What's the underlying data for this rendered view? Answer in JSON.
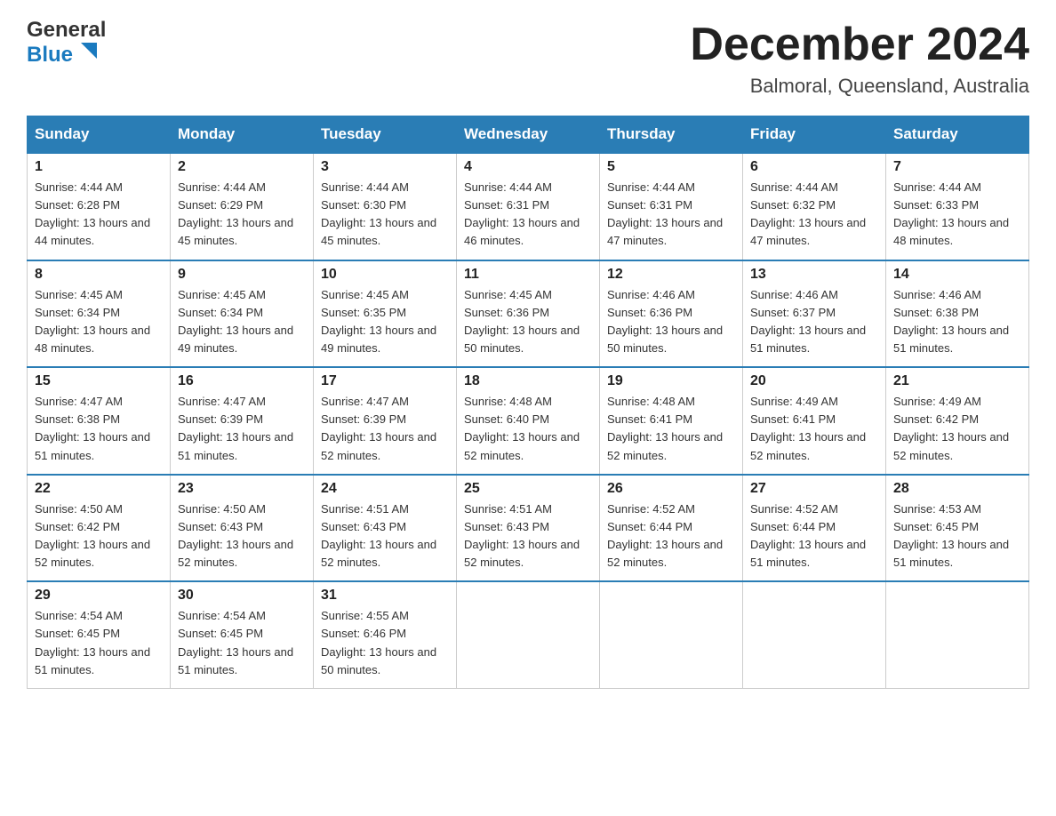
{
  "header": {
    "logo_line1": "General",
    "logo_line2": "Blue",
    "month_title": "December 2024",
    "location": "Balmoral, Queensland, Australia"
  },
  "days_of_week": [
    "Sunday",
    "Monday",
    "Tuesday",
    "Wednesday",
    "Thursday",
    "Friday",
    "Saturday"
  ],
  "weeks": [
    [
      {
        "day": "1",
        "sunrise": "4:44 AM",
        "sunset": "6:28 PM",
        "daylight": "13 hours and 44 minutes."
      },
      {
        "day": "2",
        "sunrise": "4:44 AM",
        "sunset": "6:29 PM",
        "daylight": "13 hours and 45 minutes."
      },
      {
        "day": "3",
        "sunrise": "4:44 AM",
        "sunset": "6:30 PM",
        "daylight": "13 hours and 45 minutes."
      },
      {
        "day": "4",
        "sunrise": "4:44 AM",
        "sunset": "6:31 PM",
        "daylight": "13 hours and 46 minutes."
      },
      {
        "day": "5",
        "sunrise": "4:44 AM",
        "sunset": "6:31 PM",
        "daylight": "13 hours and 47 minutes."
      },
      {
        "day": "6",
        "sunrise": "4:44 AM",
        "sunset": "6:32 PM",
        "daylight": "13 hours and 47 minutes."
      },
      {
        "day": "7",
        "sunrise": "4:44 AM",
        "sunset": "6:33 PM",
        "daylight": "13 hours and 48 minutes."
      }
    ],
    [
      {
        "day": "8",
        "sunrise": "4:45 AM",
        "sunset": "6:34 PM",
        "daylight": "13 hours and 48 minutes."
      },
      {
        "day": "9",
        "sunrise": "4:45 AM",
        "sunset": "6:34 PM",
        "daylight": "13 hours and 49 minutes."
      },
      {
        "day": "10",
        "sunrise": "4:45 AM",
        "sunset": "6:35 PM",
        "daylight": "13 hours and 49 minutes."
      },
      {
        "day": "11",
        "sunrise": "4:45 AM",
        "sunset": "6:36 PM",
        "daylight": "13 hours and 50 minutes."
      },
      {
        "day": "12",
        "sunrise": "4:46 AM",
        "sunset": "6:36 PM",
        "daylight": "13 hours and 50 minutes."
      },
      {
        "day": "13",
        "sunrise": "4:46 AM",
        "sunset": "6:37 PM",
        "daylight": "13 hours and 51 minutes."
      },
      {
        "day": "14",
        "sunrise": "4:46 AM",
        "sunset": "6:38 PM",
        "daylight": "13 hours and 51 minutes."
      }
    ],
    [
      {
        "day": "15",
        "sunrise": "4:47 AM",
        "sunset": "6:38 PM",
        "daylight": "13 hours and 51 minutes."
      },
      {
        "day": "16",
        "sunrise": "4:47 AM",
        "sunset": "6:39 PM",
        "daylight": "13 hours and 51 minutes."
      },
      {
        "day": "17",
        "sunrise": "4:47 AM",
        "sunset": "6:39 PM",
        "daylight": "13 hours and 52 minutes."
      },
      {
        "day": "18",
        "sunrise": "4:48 AM",
        "sunset": "6:40 PM",
        "daylight": "13 hours and 52 minutes."
      },
      {
        "day": "19",
        "sunrise": "4:48 AM",
        "sunset": "6:41 PM",
        "daylight": "13 hours and 52 minutes."
      },
      {
        "day": "20",
        "sunrise": "4:49 AM",
        "sunset": "6:41 PM",
        "daylight": "13 hours and 52 minutes."
      },
      {
        "day": "21",
        "sunrise": "4:49 AM",
        "sunset": "6:42 PM",
        "daylight": "13 hours and 52 minutes."
      }
    ],
    [
      {
        "day": "22",
        "sunrise": "4:50 AM",
        "sunset": "6:42 PM",
        "daylight": "13 hours and 52 minutes."
      },
      {
        "day": "23",
        "sunrise": "4:50 AM",
        "sunset": "6:43 PM",
        "daylight": "13 hours and 52 minutes."
      },
      {
        "day": "24",
        "sunrise": "4:51 AM",
        "sunset": "6:43 PM",
        "daylight": "13 hours and 52 minutes."
      },
      {
        "day": "25",
        "sunrise": "4:51 AM",
        "sunset": "6:43 PM",
        "daylight": "13 hours and 52 minutes."
      },
      {
        "day": "26",
        "sunrise": "4:52 AM",
        "sunset": "6:44 PM",
        "daylight": "13 hours and 52 minutes."
      },
      {
        "day": "27",
        "sunrise": "4:52 AM",
        "sunset": "6:44 PM",
        "daylight": "13 hours and 51 minutes."
      },
      {
        "day": "28",
        "sunrise": "4:53 AM",
        "sunset": "6:45 PM",
        "daylight": "13 hours and 51 minutes."
      }
    ],
    [
      {
        "day": "29",
        "sunrise": "4:54 AM",
        "sunset": "6:45 PM",
        "daylight": "13 hours and 51 minutes."
      },
      {
        "day": "30",
        "sunrise": "4:54 AM",
        "sunset": "6:45 PM",
        "daylight": "13 hours and 51 minutes."
      },
      {
        "day": "31",
        "sunrise": "4:55 AM",
        "sunset": "6:46 PM",
        "daylight": "13 hours and 50 minutes."
      },
      null,
      null,
      null,
      null
    ]
  ]
}
